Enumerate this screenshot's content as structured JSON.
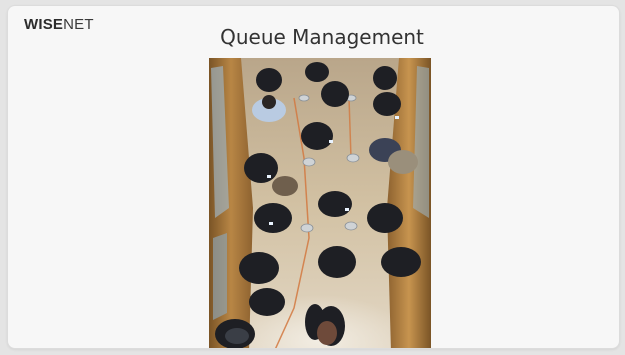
{
  "brand": {
    "logo_part1": "WISE",
    "logo_part2": "NET"
  },
  "slide": {
    "title": "Queue Management"
  },
  "video": {
    "icon": "camera-feed-image",
    "colors": {
      "floor": "#c9b79a",
      "wood": "#a6793f",
      "coat": "#1e1f24"
    }
  }
}
